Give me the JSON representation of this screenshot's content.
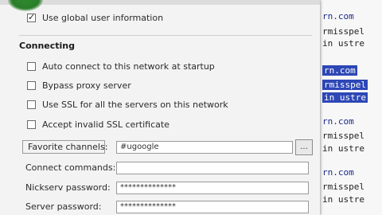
{
  "dialog": {
    "top_checkbox": {
      "label": "Use global user information",
      "checked": true
    },
    "connecting": {
      "title": "Connecting",
      "options": [
        {
          "label": "Auto connect to this network at startup",
          "checked": false
        },
        {
          "label": "Bypass proxy server",
          "checked": false
        },
        {
          "label": "Use SSL for all the servers on this network",
          "checked": false
        },
        {
          "label": "Accept invalid SSL certificate",
          "checked": false
        }
      ]
    },
    "fields": [
      {
        "label": "Favorite channels:",
        "value": "#ugoogle"
      },
      {
        "label": "Connect commands:",
        "value": ""
      },
      {
        "label": "Nickserv password:",
        "value": "**************"
      },
      {
        "label": "Server password:",
        "value": "**************"
      }
    ],
    "browse_button_label": "..."
  },
  "background_editor": {
    "lines": [
      {
        "text": "rn.com",
        "style": "com"
      },
      {
        "text": "rmisspel",
        "style": "mono"
      },
      {
        "text": "in ustre",
        "style": "mono"
      },
      {
        "text": "rn.com",
        "style": "hl"
      },
      {
        "text": "rmisspel",
        "style": "hl"
      },
      {
        "text": "in ustre",
        "style": "hl"
      },
      {
        "text": "rn.com",
        "style": "com"
      },
      {
        "text": "rmisspel",
        "style": "mono"
      },
      {
        "text": "in ustre",
        "style": "mono"
      },
      {
        "text": "rn.com",
        "style": "com"
      },
      {
        "text": "rmisspel",
        "style": "mono"
      },
      {
        "text": "in ustre",
        "style": "mono"
      }
    ]
  },
  "colors": {
    "highlight": "#2d47b6",
    "dialog_bg": "#f3f3f3",
    "accent_green": "#2a7d2a"
  }
}
